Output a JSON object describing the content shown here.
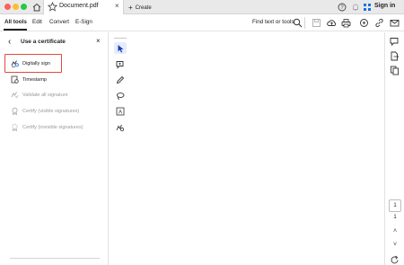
{
  "titlebar": {
    "document_tab": "Document.pdf",
    "tab_close": "×",
    "create_label": "Create",
    "sign_in": "Sign in"
  },
  "menubar": {
    "items": [
      "All tools",
      "Edit",
      "Convert",
      "E-Sign"
    ],
    "active_index": 0,
    "find_label": "Find text or tools"
  },
  "panel": {
    "back": "‹",
    "title": "Use a certificate",
    "close": "×",
    "items": [
      {
        "label": "Digitally sign",
        "icon": "digital-sign-icon",
        "enabled": true
      },
      {
        "label": "Timestamp",
        "icon": "timestamp-icon",
        "enabled": true
      },
      {
        "label": "Validate all signature",
        "icon": "validate-signature-icon",
        "enabled": false
      },
      {
        "label": "Certify (visible signatures)",
        "icon": "certify-visible-icon",
        "enabled": false
      },
      {
        "label": "Certify (invisible signatures)",
        "icon": "certify-invisible-icon",
        "enabled": false
      }
    ]
  },
  "vertical_toolbar": [
    "select-cursor-icon",
    "add-comment-icon",
    "draw-pen-icon",
    "lasso-icon",
    "add-text-icon",
    "fill-sign-icon"
  ],
  "right_rail": {
    "icons": [
      "comments-icon",
      "export-pdf-icon",
      "organize-pages-icon"
    ],
    "current_page": "1",
    "total_pages": "1",
    "up": "˄",
    "down": "˅"
  },
  "colors": {
    "accent": "#1473e6",
    "highlight_border": "#e04a3a",
    "selected_tool_bg": "#e6ecfb"
  }
}
